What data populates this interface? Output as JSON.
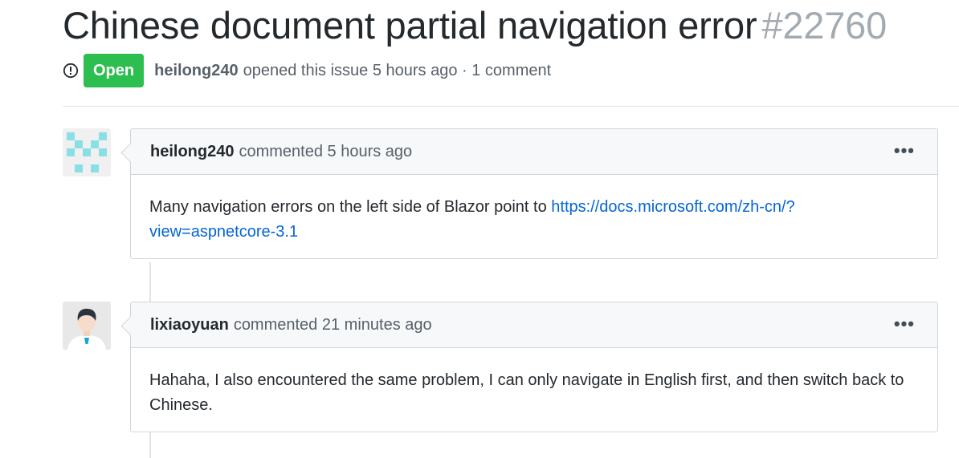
{
  "issue": {
    "title": "Chinese document partial navigation error",
    "number": "#22760",
    "state": "Open",
    "author": "heilong240",
    "opened_text": "opened this issue 5 hours ago · 1 comment",
    "state_icon": "issue-opened-icon",
    "state_color": "#2cbe4e"
  },
  "comments": [
    {
      "author": "heilong240",
      "meta": "commented 5 hours ago",
      "avatar": "identicon-avatar",
      "body_text": "Many navigation errors on the left side of Blazor point to ",
      "body_link": "https://docs.microsoft.com/zh-cn/?view=aspnetcore-3.1",
      "menu_icon": "kebab-horizontal-icon"
    },
    {
      "author": "lixiaoyuan",
      "meta": "commented 21 minutes ago",
      "avatar": "person-avatar",
      "body_text": "Hahaha, I also encountered the same problem, I can only navigate in English first, and then switch back to Chinese.",
      "menu_icon": "kebab-horizontal-icon"
    }
  ]
}
